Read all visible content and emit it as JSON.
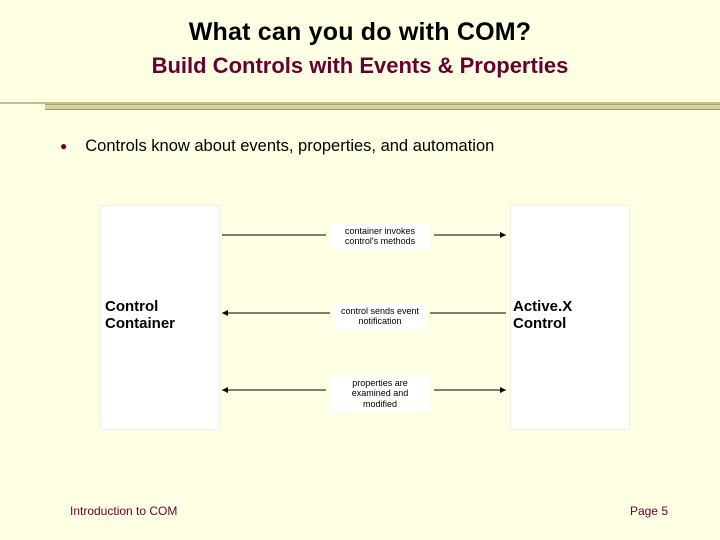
{
  "header": {
    "title": "What can you do with COM?",
    "subtitle": "Build Controls with Events & Properties"
  },
  "bullet": {
    "text": "Controls know about events, properties, and automation"
  },
  "diagram": {
    "left_box_label": "Control Container",
    "right_box_label": "Active.X Control",
    "annotation_top": "container invokes control's methods",
    "annotation_mid": "control sends event notification",
    "annotation_bot": "properties are examined and modified"
  },
  "footer": {
    "left": "Introduction to COM",
    "right_label": "Page",
    "page_number": "5"
  }
}
